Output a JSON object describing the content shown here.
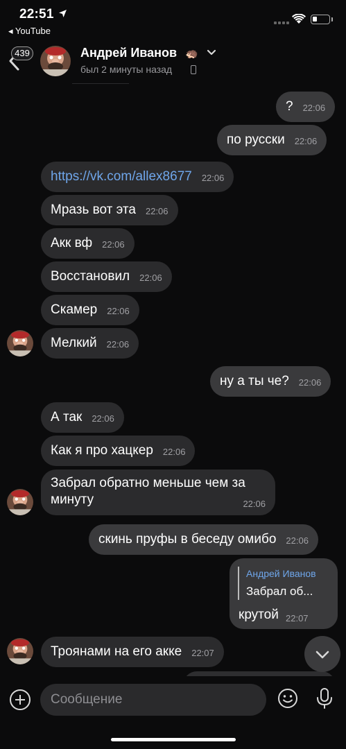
{
  "status_bar": {
    "time": "22:51",
    "back_app": "◂ YouTube"
  },
  "header": {
    "unread_count": "439",
    "contact_name": "Андрей Иванов",
    "name_emoji": "🦔",
    "last_seen": "был 2 минуты назад"
  },
  "messages": [
    {
      "dir": "out",
      "text": "?",
      "time": "22:06"
    },
    {
      "dir": "out",
      "text": "по русски",
      "time": "22:06"
    },
    {
      "dir": "in",
      "text": "https://vk.com/allex8677",
      "time": "22:06",
      "link": true
    },
    {
      "dir": "in",
      "text": "Мразь вот эта",
      "time": "22:06"
    },
    {
      "dir": "in",
      "text": "Акк вф",
      "time": "22:06"
    },
    {
      "dir": "in",
      "text": "Восстановил",
      "time": "22:06"
    },
    {
      "dir": "in",
      "text": "Скамер",
      "time": "22:06"
    },
    {
      "dir": "in",
      "text": "Мелкий",
      "time": "22:06"
    },
    {
      "dir": "out",
      "text": "ну а ты че?",
      "time": "22:06"
    },
    {
      "dir": "in",
      "text": "А так",
      "time": "22:06"
    },
    {
      "dir": "in",
      "text": "Как я про хацкер",
      "time": "22:06"
    },
    {
      "dir": "in",
      "text": "Забрал обратно меньше чем за минуту",
      "time": "22:06"
    },
    {
      "dir": "out",
      "text": "скинь пруфы в беседу омибо",
      "time": "22:06"
    },
    {
      "dir": "out",
      "reply_to_name": "Андрей Иванов",
      "reply_to_text": "Забрал об...",
      "text": "крутой",
      "time": "22:07"
    },
    {
      "dir": "in",
      "text": "Троянами на его акке",
      "time": "22:07"
    }
  ],
  "composer": {
    "placeholder": "Сообщение"
  },
  "colors": {
    "link": "#6fa6ea",
    "incoming_bubble": "#2b2b2d",
    "outgoing_bubble": "#3a3a3c"
  },
  "icons": [
    "location-arrow-icon",
    "cellular-icon",
    "wifi-icon",
    "battery-icon",
    "back-chevron-icon",
    "chevron-down-icon",
    "phone-icon",
    "scroll-down-icon",
    "plus-icon",
    "emoji-icon",
    "mic-icon"
  ]
}
